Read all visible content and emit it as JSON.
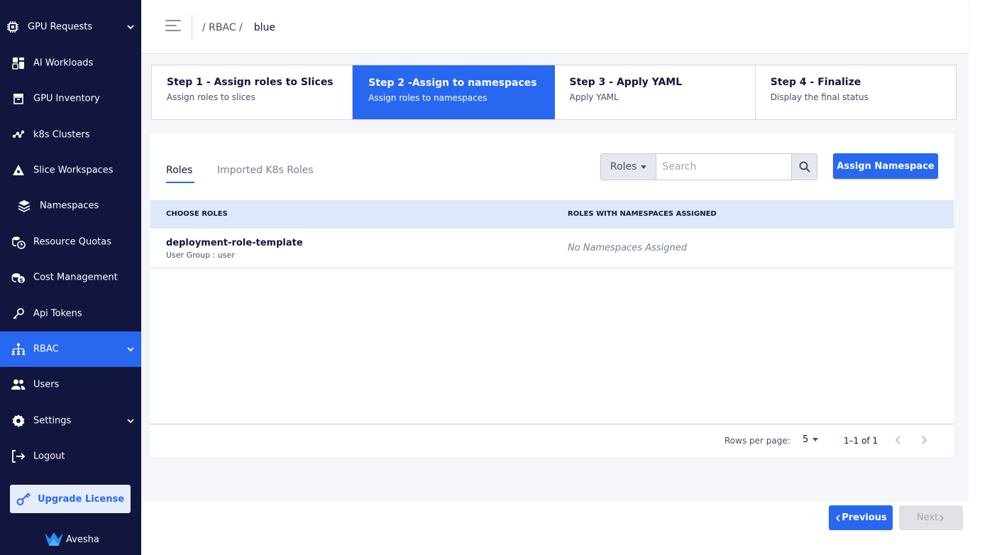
{
  "sidebar": {
    "items": [
      {
        "label": "GPU Requests",
        "icon": "chip-icon"
      },
      {
        "label": "AI Workloads",
        "icon": "dashboard-icon"
      },
      {
        "label": "GPU Inventory",
        "icon": "inventory-icon"
      },
      {
        "label": "k8s Clusters",
        "icon": "cluster-icon"
      },
      {
        "label": "Slice Workspaces",
        "icon": "slice-icon"
      },
      {
        "label": "Namespaces",
        "icon": "layers-icon"
      },
      {
        "label": "Resource Quotas",
        "icon": "quota-icon"
      },
      {
        "label": "Cost Management",
        "icon": "coins-icon"
      },
      {
        "label": "Api Tokens",
        "icon": "key-icon"
      },
      {
        "label": "RBAC",
        "icon": "rbac-icon"
      },
      {
        "label": "Users",
        "icon": "users-icon"
      },
      {
        "label": "Settings",
        "icon": "gear-icon"
      },
      {
        "label": "Logout",
        "icon": "logout-icon"
      }
    ],
    "active": "RBAC",
    "upgrade_label": "Upgrade License",
    "logo_text": "Avesha"
  },
  "header": {
    "breadcrumb_root": "/ RBAC /",
    "breadcrumb_current": "blue"
  },
  "stepper": [
    {
      "title": "Step 1 - Assign roles to Slices",
      "subtitle": "Assign roles to slices"
    },
    {
      "title": "Step 2 -Assign to namespaces",
      "subtitle": "Assign roles to namespaces"
    },
    {
      "title": "Step 3 - Apply YAML",
      "subtitle": "Apply YAML"
    },
    {
      "title": "Step 4 - Finalize",
      "subtitle": "Display the final status"
    }
  ],
  "active_step": 2,
  "tabs": {
    "roles": "Roles",
    "imported": "Imported K8s Roles"
  },
  "search": {
    "filter_value": "Roles",
    "placeholder": "Search"
  },
  "assign_button": "Assign Namespace",
  "table": {
    "headers": [
      "CHOOSE ROLES",
      "ROLES WITH NAMESPACES ASSIGNED"
    ],
    "rows": [
      {
        "role": "deployment-role-template",
        "group": "User Group : user",
        "namespaces": "No Namespaces Assigned"
      }
    ]
  },
  "pagination": {
    "rows_per_page_label": "Rows per page:",
    "rows_per_page": "5",
    "range": "1–1 of 1"
  },
  "footer": {
    "previous": "Previous",
    "next": "Next"
  },
  "colors": {
    "sidebar_bg": "#12153e",
    "accent": "#2868f0",
    "table_head_bg": "#dde8fb"
  }
}
